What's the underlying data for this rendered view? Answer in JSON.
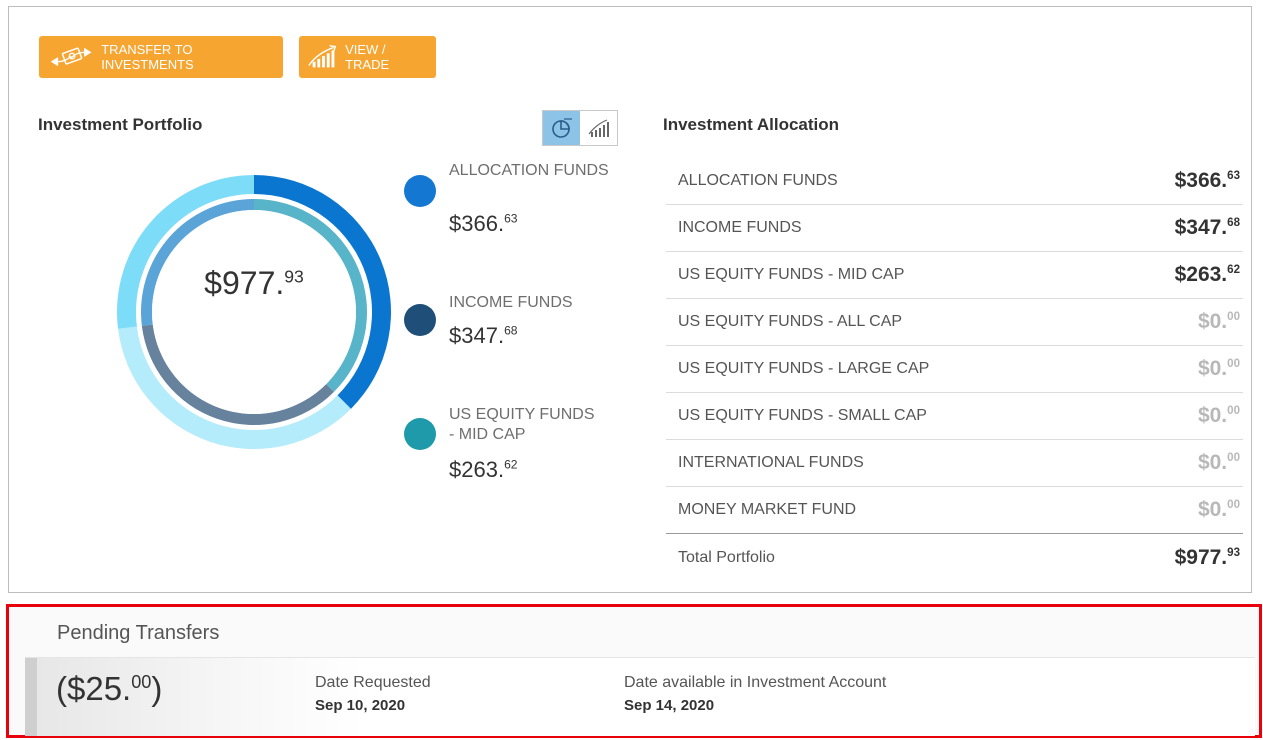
{
  "toolbar": {
    "transfer_label": "TRANSFER TO INVESTMENTS",
    "trade_label": "VIEW / TRADE",
    "accent_color": "#f6a531"
  },
  "portfolio": {
    "title": "Investment Portfolio",
    "total_main": "$977.",
    "total_cents": "93",
    "view_toggle": {
      "active": "pie-chart-icon",
      "inactive": "growth-chart-icon"
    },
    "legend": [
      {
        "name": "ALLOCATION FUNDS",
        "dollars": "$366.",
        "cents": "63",
        "color": "#1478d2"
      },
      {
        "name": "INCOME FUNDS",
        "dollars": "$347.",
        "cents": "68",
        "color": "#1f4e79"
      },
      {
        "name": "US EQUITY FUNDS - MID CAP",
        "dollars": "$263.",
        "cents": "62",
        "color": "#1f9aaa"
      }
    ]
  },
  "allocation": {
    "title": "Investment Allocation",
    "rows": [
      {
        "name": "ALLOCATION FUNDS",
        "dollars": "$366.",
        "cents": "63"
      },
      {
        "name": "INCOME FUNDS",
        "dollars": "$347.",
        "cents": "68"
      },
      {
        "name": "US EQUITY FUNDS - MID CAP",
        "dollars": "$263.",
        "cents": "62"
      },
      {
        "name": "US EQUITY FUNDS - ALL CAP",
        "dollars": "$0.",
        "cents": "00"
      },
      {
        "name": "US EQUITY FUNDS - LARGE CAP",
        "dollars": "$0.",
        "cents": "00"
      },
      {
        "name": "US EQUITY FUNDS - SMALL CAP",
        "dollars": "$0.",
        "cents": "00"
      },
      {
        "name": "INTERNATIONAL FUNDS",
        "dollars": "$0.",
        "cents": "00"
      },
      {
        "name": "MONEY MARKET FUND",
        "dollars": "$0.",
        "cents": "00"
      }
    ],
    "total": {
      "name": "Total Portfolio",
      "dollars": "$977.",
      "cents": "93"
    }
  },
  "pending": {
    "title": "Pending Transfers",
    "amount_prefix": "($25.",
    "amount_cents": "00",
    "amount_suffix": ")",
    "requested_label": "Date Requested",
    "requested_date": "Sep 10, 2020",
    "available_label": "Date available in Investment Account",
    "available_date": "Sep 14, 2020"
  }
}
